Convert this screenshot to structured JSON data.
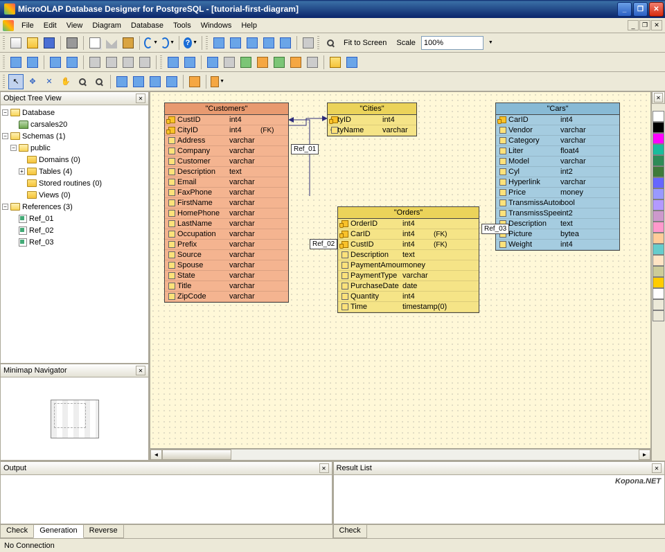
{
  "window": {
    "title": "MicroOLAP Database Designer for PostgreSQL - [tutorial-first-diagram]"
  },
  "menu": {
    "file": "File",
    "edit": "Edit",
    "view": "View",
    "diagram": "Diagram",
    "database": "Database",
    "tools": "Tools",
    "windows": "Windows",
    "help": "Help"
  },
  "toolbar": {
    "fit": "Fit to Screen",
    "scale_label": "Scale",
    "scale_value": "100%"
  },
  "tree_title": "Object Tree View",
  "tree": {
    "database": "Database",
    "db_name": "carsales20",
    "schemas": "Schemas (1)",
    "public": "public",
    "domains": "Domains (0)",
    "tables": "Tables (4)",
    "stored": "Stored routines (0)",
    "views": "Views (0)",
    "references": "References (3)",
    "ref1": "Ref_01",
    "ref2": "Ref_02",
    "ref3": "Ref_03"
  },
  "minimap_title": "Minimap Navigator",
  "tables": {
    "customers": {
      "title": "\"Customers\"",
      "cols": [
        {
          "n": "CustID",
          "t": "int4",
          "pk": true
        },
        {
          "n": "CityID",
          "t": "int4",
          "fk": "(FK)",
          "pk": true
        },
        {
          "n": "Address",
          "t": "varchar"
        },
        {
          "n": "Company",
          "t": "varchar"
        },
        {
          "n": "Customer",
          "t": "varchar"
        },
        {
          "n": "Description",
          "t": "text"
        },
        {
          "n": "Email",
          "t": "varchar"
        },
        {
          "n": "FaxPhone",
          "t": "varchar"
        },
        {
          "n": "FirstName",
          "t": "varchar"
        },
        {
          "n": "HomePhone",
          "t": "varchar"
        },
        {
          "n": "LastName",
          "t": "varchar"
        },
        {
          "n": "Occupation",
          "t": "varchar"
        },
        {
          "n": "Prefix",
          "t": "varchar"
        },
        {
          "n": "Source",
          "t": "varchar"
        },
        {
          "n": "Spouse",
          "t": "varchar"
        },
        {
          "n": "State",
          "t": "varchar"
        },
        {
          "n": "Title",
          "t": "varchar"
        },
        {
          "n": "ZipCode",
          "t": "varchar"
        }
      ]
    },
    "cities": {
      "title": "\"Cities\"",
      "cols": [
        {
          "n": "CityID",
          "t": "int4",
          "pk": true
        },
        {
          "n": "CityName",
          "t": "varchar"
        }
      ]
    },
    "orders": {
      "title": "\"Orders\"",
      "cols": [
        {
          "n": "OrderID",
          "t": "int4",
          "pk": true
        },
        {
          "n": "CarID",
          "t": "int4",
          "fk": "(FK)",
          "pk": true
        },
        {
          "n": "CustID",
          "t": "int4",
          "fk": "(FK)",
          "pk": true
        },
        {
          "n": "Description",
          "t": "text"
        },
        {
          "n": "PaymentAmount",
          "t": "money"
        },
        {
          "n": "PaymentType",
          "t": "varchar"
        },
        {
          "n": "PurchaseDate",
          "t": "date"
        },
        {
          "n": "Quantity",
          "t": "int4"
        },
        {
          "n": "Time",
          "t": "timestamp(0)"
        }
      ]
    },
    "cars": {
      "title": "\"Cars\"",
      "cols": [
        {
          "n": "CarID",
          "t": "int4",
          "pk": true
        },
        {
          "n": "Vendor",
          "t": "varchar"
        },
        {
          "n": "Category",
          "t": "varchar"
        },
        {
          "n": "Liter",
          "t": "float4"
        },
        {
          "n": "Model",
          "t": "varchar"
        },
        {
          "n": "Cyl",
          "t": "int2"
        },
        {
          "n": "Hyperlink",
          "t": "varchar"
        },
        {
          "n": "Price",
          "t": "money"
        },
        {
          "n": "TransmissAutomatic",
          "t": "bool"
        },
        {
          "n": "TransmissSpeedCount",
          "t": "int2"
        },
        {
          "n": "Description",
          "t": "text"
        },
        {
          "n": "Picture",
          "t": "bytea"
        },
        {
          "n": "Weight",
          "t": "int4"
        }
      ]
    }
  },
  "refs": {
    "r1": "Ref_01",
    "r2": "Ref_02",
    "r3": "Ref_03"
  },
  "colors": [
    "#ffffff",
    "#000000",
    "#ff00ff",
    "#1abc9c",
    "#2e8b57",
    "#3f7a3a",
    "#6666ff",
    "#9999ff",
    "#b399ff",
    "#cc99cc",
    "#ff99cc",
    "#ffcc99",
    "#66cccc",
    "#ffe4c4",
    "#cccc99",
    "#ffcc00",
    "#ffffff",
    "#ece9d8",
    "#ece9d8"
  ],
  "output_title": "Output",
  "result_title": "Result List",
  "tabs": {
    "check": "Check",
    "generation": "Generation",
    "reverse": "Reverse",
    "result_check": "Check"
  },
  "status": "No Connection",
  "watermark": "Kopona.NET"
}
